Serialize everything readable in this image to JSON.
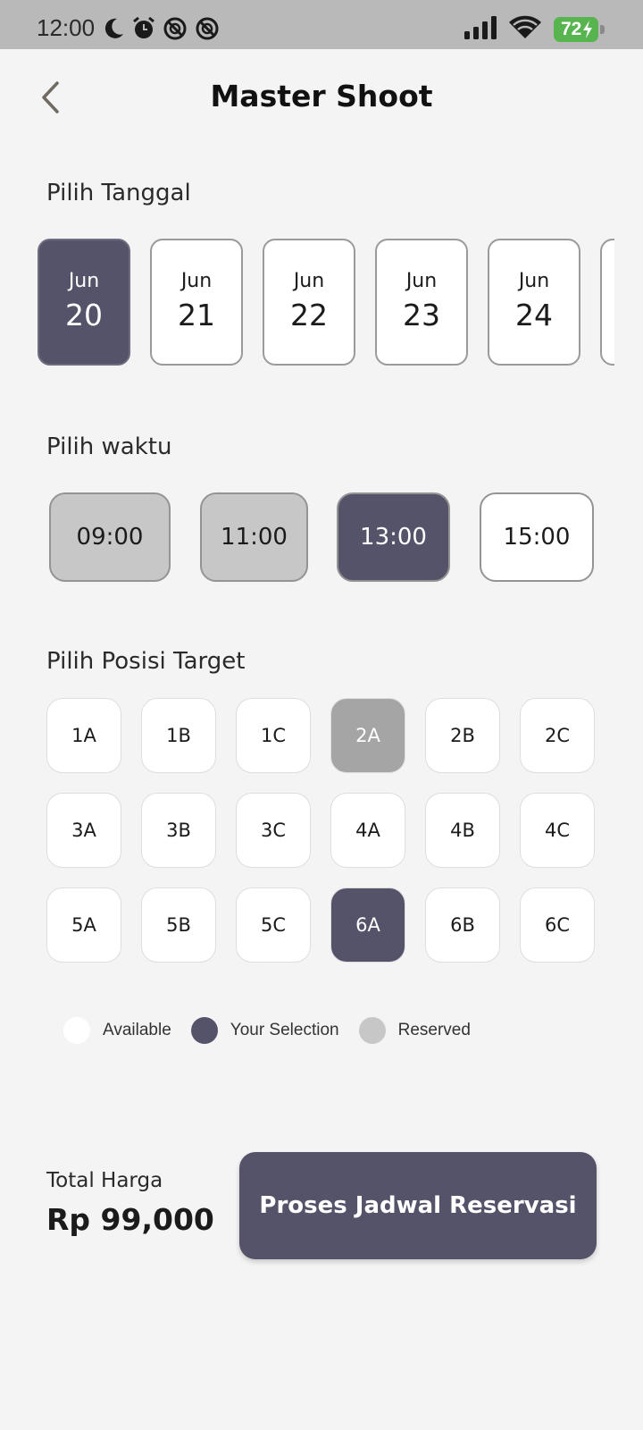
{
  "status_bar": {
    "time": "12:00",
    "battery": "72"
  },
  "header": {
    "title": "Master Shoot"
  },
  "date_section": {
    "label": "Pilih Tanggal",
    "dates": [
      {
        "month": "Jun",
        "day": "20",
        "selected": true
      },
      {
        "month": "Jun",
        "day": "21",
        "selected": false
      },
      {
        "month": "Jun",
        "day": "22",
        "selected": false
      },
      {
        "month": "Jun",
        "day": "23",
        "selected": false
      },
      {
        "month": "Jun",
        "day": "24",
        "selected": false
      },
      {
        "month": "",
        "day": "",
        "selected": false
      }
    ]
  },
  "time_section": {
    "label": "Pilih waktu",
    "times": [
      {
        "label": "09:00",
        "state": "reserved"
      },
      {
        "label": "11:00",
        "state": "reserved"
      },
      {
        "label": "13:00",
        "state": "selected"
      },
      {
        "label": "15:00",
        "state": "available"
      }
    ]
  },
  "position_section": {
    "label": "Pilih Posisi Target",
    "rows": [
      [
        {
          "label": "1A",
          "state": "available"
        },
        {
          "label": "1B",
          "state": "available"
        },
        {
          "label": "1C",
          "state": "available"
        },
        {
          "label": "2A",
          "state": "reserved"
        },
        {
          "label": "2B",
          "state": "available"
        },
        {
          "label": "2C",
          "state": "available"
        }
      ],
      [
        {
          "label": "3A",
          "state": "available"
        },
        {
          "label": "3B",
          "state": "available"
        },
        {
          "label": "3C",
          "state": "available"
        },
        {
          "label": "4A",
          "state": "available"
        },
        {
          "label": "4B",
          "state": "available"
        },
        {
          "label": "4C",
          "state": "available"
        }
      ],
      [
        {
          "label": "5A",
          "state": "available"
        },
        {
          "label": "5B",
          "state": "available"
        },
        {
          "label": "5C",
          "state": "available"
        },
        {
          "label": "6A",
          "state": "selected"
        },
        {
          "label": "6B",
          "state": "available"
        },
        {
          "label": "6C",
          "state": "available"
        }
      ]
    ]
  },
  "legend": {
    "available": "Available",
    "selection": "Your Selection",
    "reserved": "Reserved"
  },
  "footer": {
    "total_label": "Total Harga",
    "total_price": "Rp 99,000",
    "submit_label": "Proses Jadwal Reservasi"
  },
  "colors": {
    "selected": "#55536a",
    "reserved_time": "#c7c7c7",
    "reserved_seat": "#a5a5a5",
    "available": "#ffffff",
    "battery": "#58b44f"
  },
  "icons": {
    "back": "chevron-left-icon",
    "moon": "moon-icon",
    "alarm": "alarm-clock-icon",
    "dnd": "blocked-circle-icon",
    "signal": "cellular-signal-icon",
    "wifi": "wifi-icon",
    "battery": "battery-icon",
    "charging": "lightning-bolt-icon"
  }
}
